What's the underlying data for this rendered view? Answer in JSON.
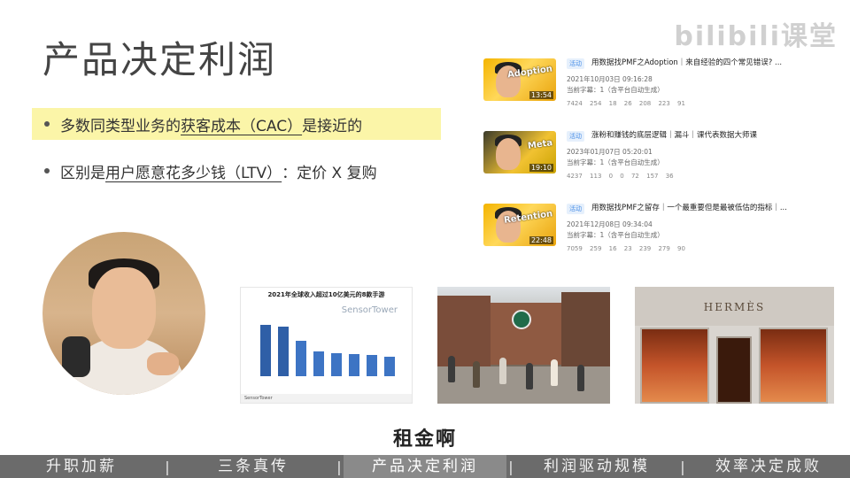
{
  "slide": {
    "title": "产品决定利润",
    "watermark": "bilibili课堂",
    "bullets": [
      {
        "pre": "多数同类型业务的",
        "ul": "获客成本（CAC）",
        "post": "是接近的"
      },
      {
        "pre": "区别是",
        "ul": "用户愿意花多少钱（LTV）",
        "post": "：定价 X 复购"
      }
    ]
  },
  "videos": [
    {
      "tag": "活动",
      "title": "用数据找PMF之Adoption｜来自经验的四个常见错误? ...",
      "date": "2021年10月03日 09:16:28",
      "sub": "当前字幕：1（含平台自动生成）",
      "thumb_text": "Adoption",
      "duration": "13:54",
      "stats": "7424 254 18 26 208 223 91"
    },
    {
      "tag": "活动",
      "title": "涨粉和赚钱的底层逻辑｜漏斗｜课代表数据大师课",
      "date": "2023年01月07日 05:20:01",
      "sub": "当前字幕：1（含平台自动生成）",
      "thumb_text": "Meta",
      "duration": "19:10",
      "stats": "4237 113 0 0 72 157 36"
    },
    {
      "tag": "活动",
      "title": "用数据找PMF之留存｜一个最重要但是最被低估的指标｜...",
      "date": "2021年12月08日 09:34:04",
      "sub": "当前字幕：1（含平台自动生成）",
      "thumb_text": "Retention",
      "duration": "22:48",
      "stats": "7059 259 16 23 239 279 90"
    }
  ],
  "chart_image": {
    "title": "2021年全球收入超过10亿美元的8款手游",
    "logo": "SensorTower",
    "footer": "SensorTower"
  },
  "hermes_image": {
    "brand": "HERMÈS"
  },
  "caption": "租金啊",
  "navbar": {
    "items": [
      "升职加薪",
      "三条真传",
      "产品决定利润",
      "利润驱动规模",
      "效率决定成败"
    ],
    "separator": "|",
    "active_index": 2
  }
}
